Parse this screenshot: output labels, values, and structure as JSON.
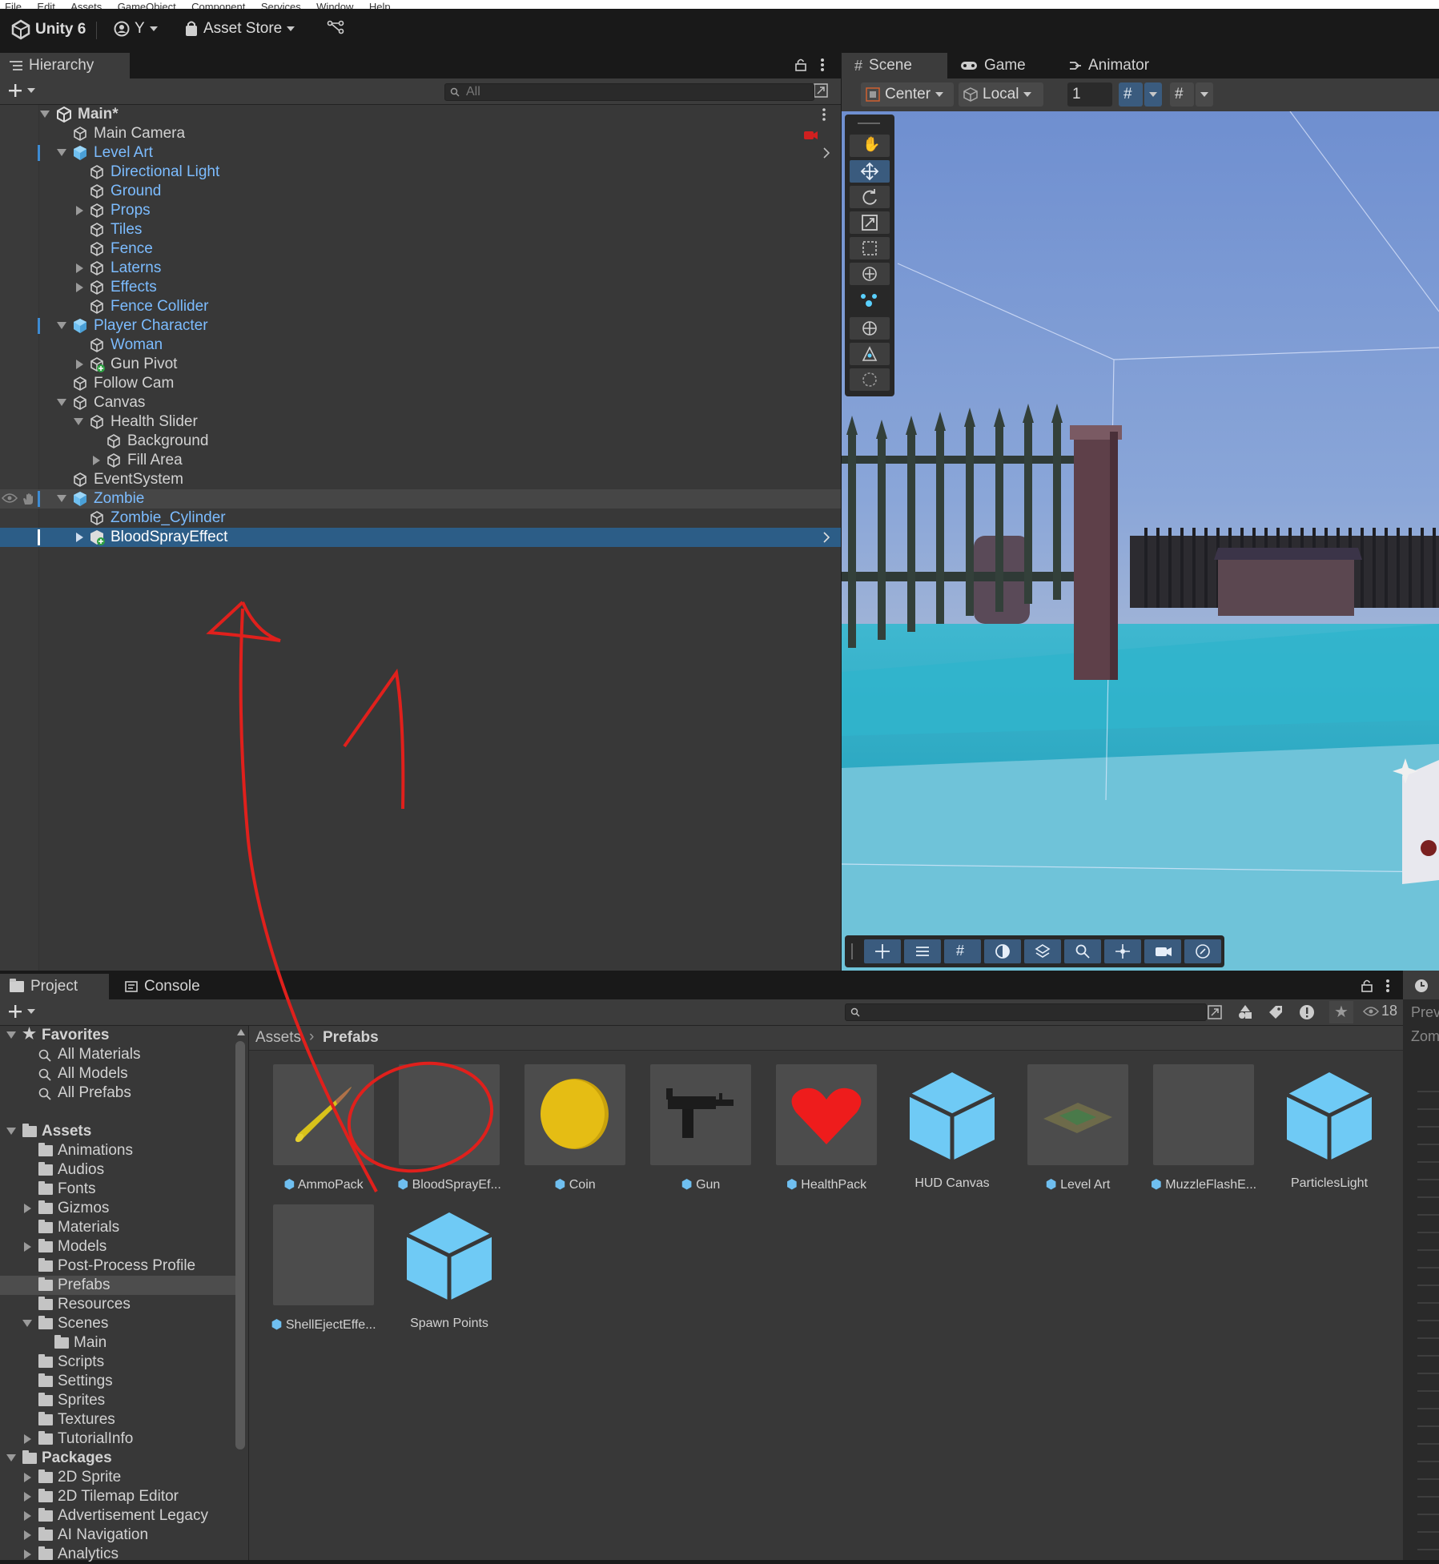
{
  "menubar": [
    "File",
    "Edit",
    "Assets",
    "GameObject",
    "Component",
    "Services",
    "Window",
    "Help"
  ],
  "toolbar": {
    "unity_label": "Unity 6",
    "account_label": "Y",
    "asset_store_label": "Asset Store"
  },
  "hierarchy": {
    "tab_label": "Hierarchy",
    "search_placeholder": "All",
    "rows": [
      {
        "label": "Main*"
      },
      {
        "label": "Main Camera"
      },
      {
        "label": "Level Art"
      },
      {
        "label": "Directional Light"
      },
      {
        "label": "Ground"
      },
      {
        "label": "Props"
      },
      {
        "label": "Tiles"
      },
      {
        "label": "Fence"
      },
      {
        "label": "Laterns"
      },
      {
        "label": "Effects"
      },
      {
        "label": "Fence Collider"
      },
      {
        "label": "Player Character"
      },
      {
        "label": "Woman"
      },
      {
        "label": "Gun Pivot"
      },
      {
        "label": "Follow Cam"
      },
      {
        "label": "Canvas"
      },
      {
        "label": "Health Slider"
      },
      {
        "label": "Background"
      },
      {
        "label": "Fill Area"
      },
      {
        "label": "EventSystem"
      },
      {
        "label": "Zombie"
      },
      {
        "label": "Zombie_Cylinder"
      },
      {
        "label": "BloodSprayEffect"
      }
    ]
  },
  "scene": {
    "tabs": [
      {
        "label": "Scene"
      },
      {
        "label": "Game"
      },
      {
        "label": "Animator"
      }
    ],
    "pivot_label": "Center",
    "space_label": "Local",
    "snap_value": "1"
  },
  "project": {
    "tabs": [
      {
        "label": "Project"
      },
      {
        "label": "Console"
      }
    ],
    "visible_count": "18",
    "breadcrumb": {
      "root": "Assets",
      "current": "Prefabs"
    },
    "favorites": {
      "label": "Favorites",
      "items": [
        "All Materials",
        "All Models",
        "All Prefabs"
      ]
    },
    "assets_label": "Assets",
    "folders": [
      "Animations",
      "Audios",
      "Fonts",
      "Gizmos",
      "Materials",
      "Models",
      "Post-Process Profile",
      "Prefabs",
      "Resources",
      "Scenes",
      "Main",
      "Scripts",
      "Settings",
      "Sprites",
      "Textures",
      "TutorialInfo"
    ],
    "packages_label": "Packages",
    "packages": [
      "2D Sprite",
      "2D Tilemap Editor",
      "Advertisement Legacy",
      "AI Navigation",
      "Analytics"
    ],
    "assets_grid": [
      {
        "name": "AmmoPack"
      },
      {
        "name": "BloodSprayEf..."
      },
      {
        "name": "Coin"
      },
      {
        "name": "Gun"
      },
      {
        "name": "HealthPack"
      },
      {
        "name": "HUD Canvas"
      },
      {
        "name": "Level Art"
      },
      {
        "name": "MuzzleFlashE..."
      },
      {
        "name": "ParticlesLight"
      },
      {
        "name": "ShellEjectEffe..."
      },
      {
        "name": "Spawn Points"
      }
    ],
    "right_panel": {
      "label_1": "Prev",
      "label_2": "Zom"
    }
  },
  "colors": {
    "accent": "#2c5d87",
    "prefab_blue": "#7cbcff",
    "annotation_red": "#e0201c",
    "cube_blue": "#6fcaf5"
  }
}
